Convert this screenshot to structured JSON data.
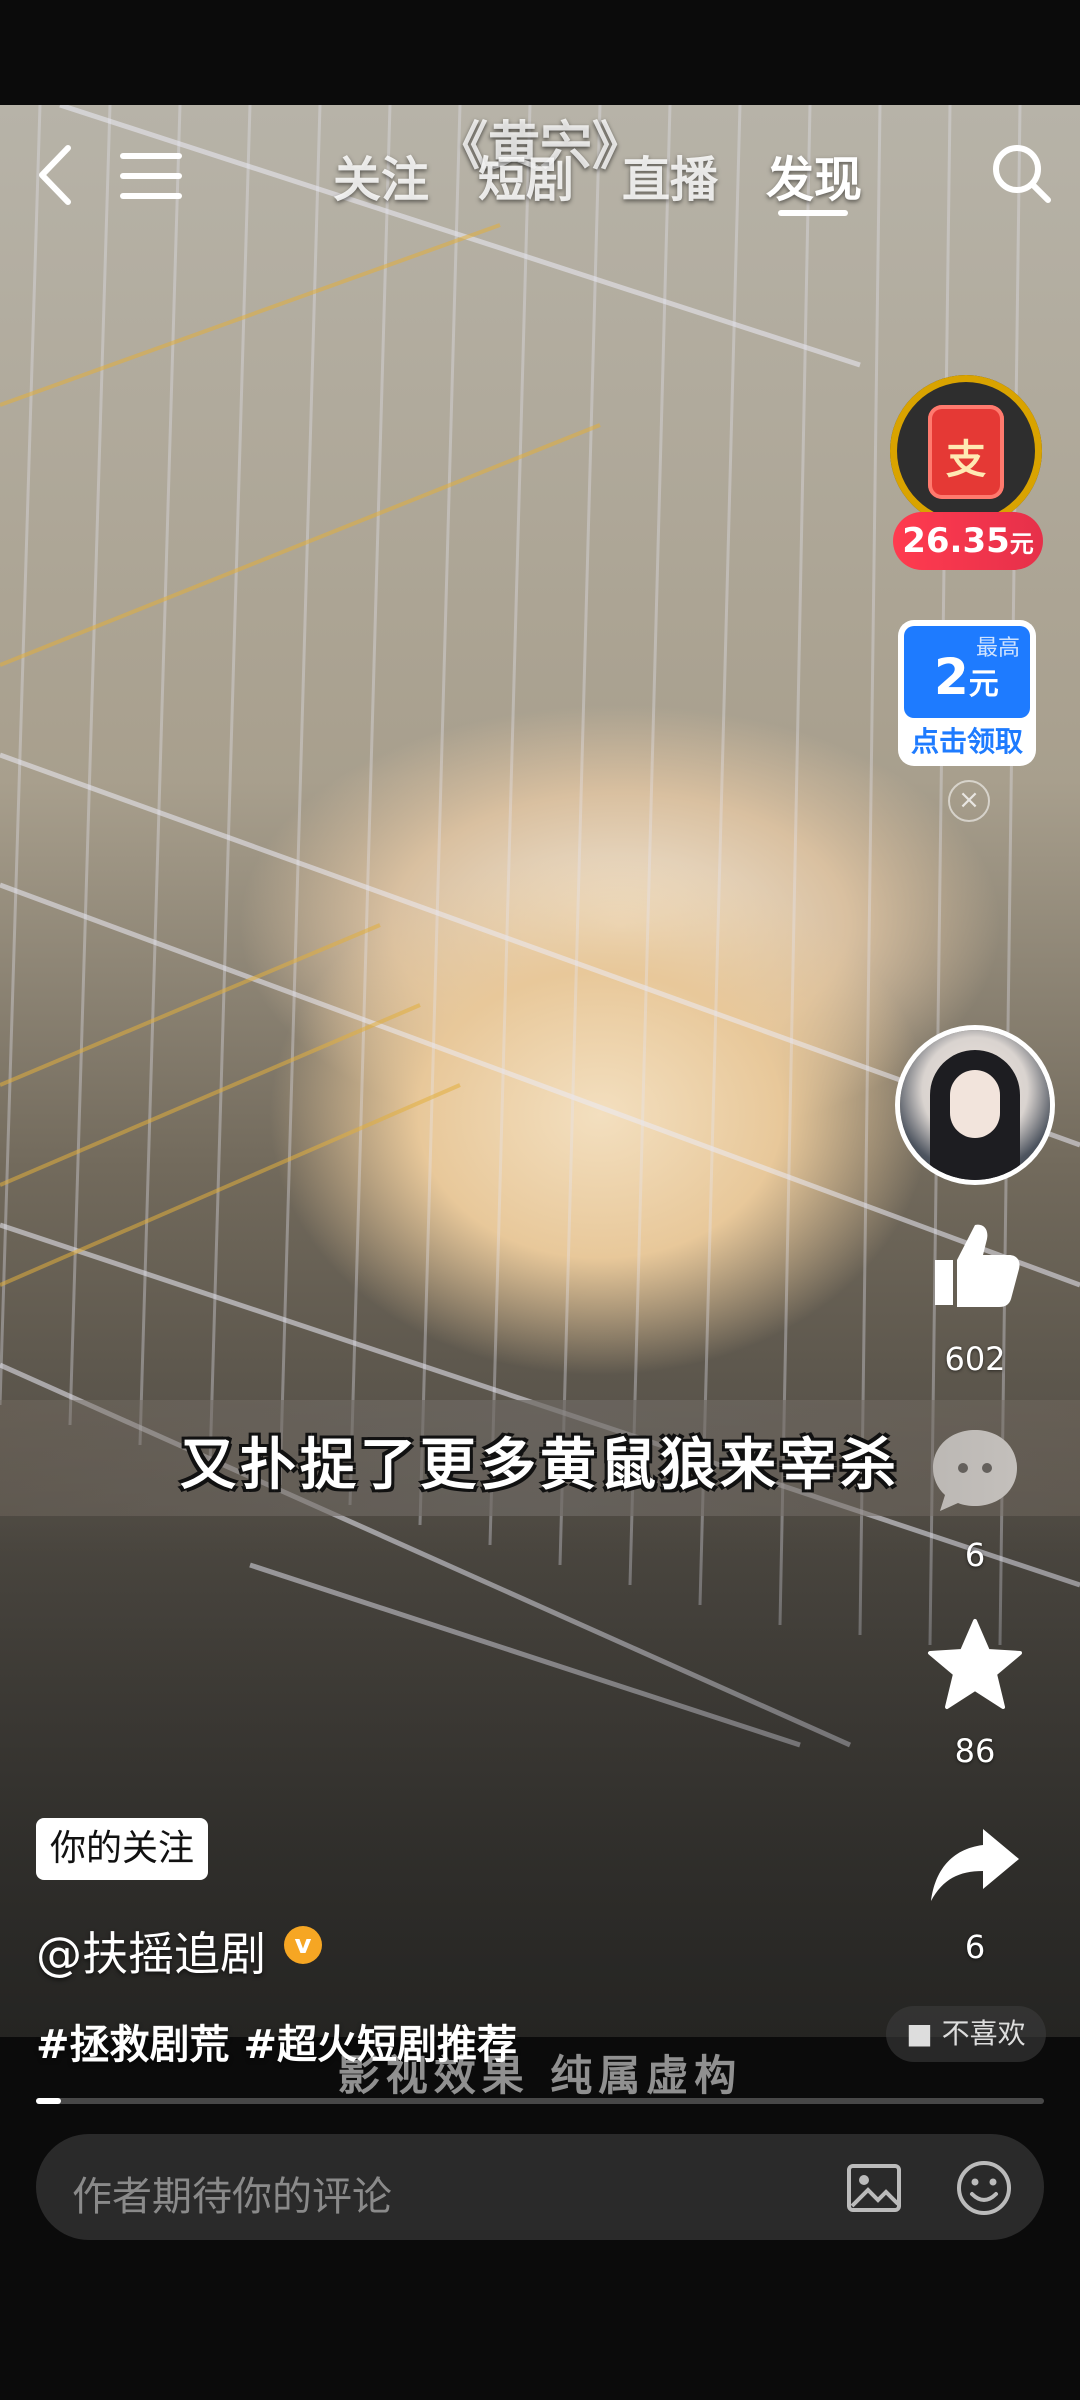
{
  "header": {
    "tabs": [
      {
        "label": "关注",
        "active": false
      },
      {
        "label": "短剧",
        "active": false
      },
      {
        "label": "直播",
        "active": false
      },
      {
        "label": "发现",
        "active": true
      }
    ],
    "title_overlay": "《黄宍》"
  },
  "rewards": {
    "red_packet_glyph": "支",
    "amount_value": "26.35",
    "amount_unit": "元",
    "coupon_max_label": "最高",
    "coupon_value": "2",
    "coupon_unit": "元",
    "coupon_cta": "点击领取",
    "close_glyph": "×"
  },
  "actions": {
    "likes": "602",
    "comments": "6",
    "favorites": "86",
    "shares": "6"
  },
  "video": {
    "subtitle": "又扑捉了更多黄鼠狼来宰杀",
    "disclaimer": "影视效果 纯属虚构",
    "progress": 0.025
  },
  "info": {
    "follow_tag": "你的关注",
    "author": "@扶摇追剧",
    "verified_glyph": "v",
    "hashtags": "#拯救剧荒 #超火短剧推荐",
    "dislike_label": "不喜欢"
  },
  "comment": {
    "placeholder": "作者期待你的评论"
  },
  "colors": {
    "accent_blue": "#1e7bff",
    "reward_red": "#e6304a",
    "ring_gold": "#d9a300",
    "verified_orange": "#f6a623"
  }
}
